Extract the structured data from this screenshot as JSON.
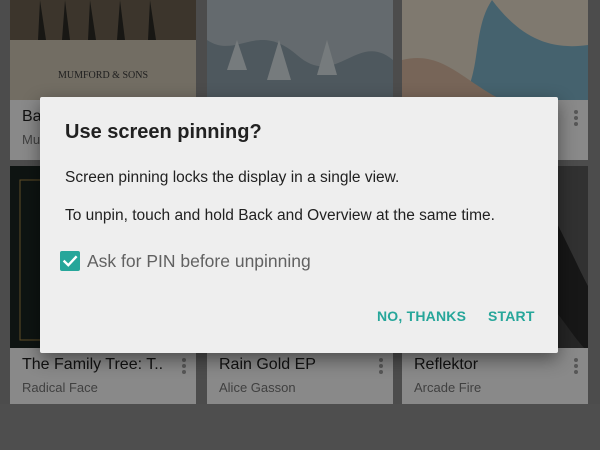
{
  "albums": [
    {
      "title": "Ba",
      "artist": "Mu",
      "art_text": "MUMFORD & SONS"
    },
    {
      "title": "",
      "artist": ""
    },
    {
      "title": "",
      "artist": ""
    },
    {
      "title": "The Family Tree: T..",
      "artist": "Radical Face"
    },
    {
      "title": "Rain Gold EP",
      "artist": "Alice Gasson"
    },
    {
      "title": "Reflektor",
      "artist": "Arcade Fire"
    }
  ],
  "dialog": {
    "title": "Use screen pinning?",
    "line1": "Screen pinning locks the display in a single view.",
    "line2": "To unpin, touch and hold Back and Overview at the same time.",
    "checkbox_label": "Ask for PIN before unpinning",
    "checkbox_checked": true,
    "cancel_label": "NO, THANKS",
    "confirm_label": "START"
  },
  "colors": {
    "accent": "#26a69a",
    "dialog_bg": "#eeeeee"
  }
}
